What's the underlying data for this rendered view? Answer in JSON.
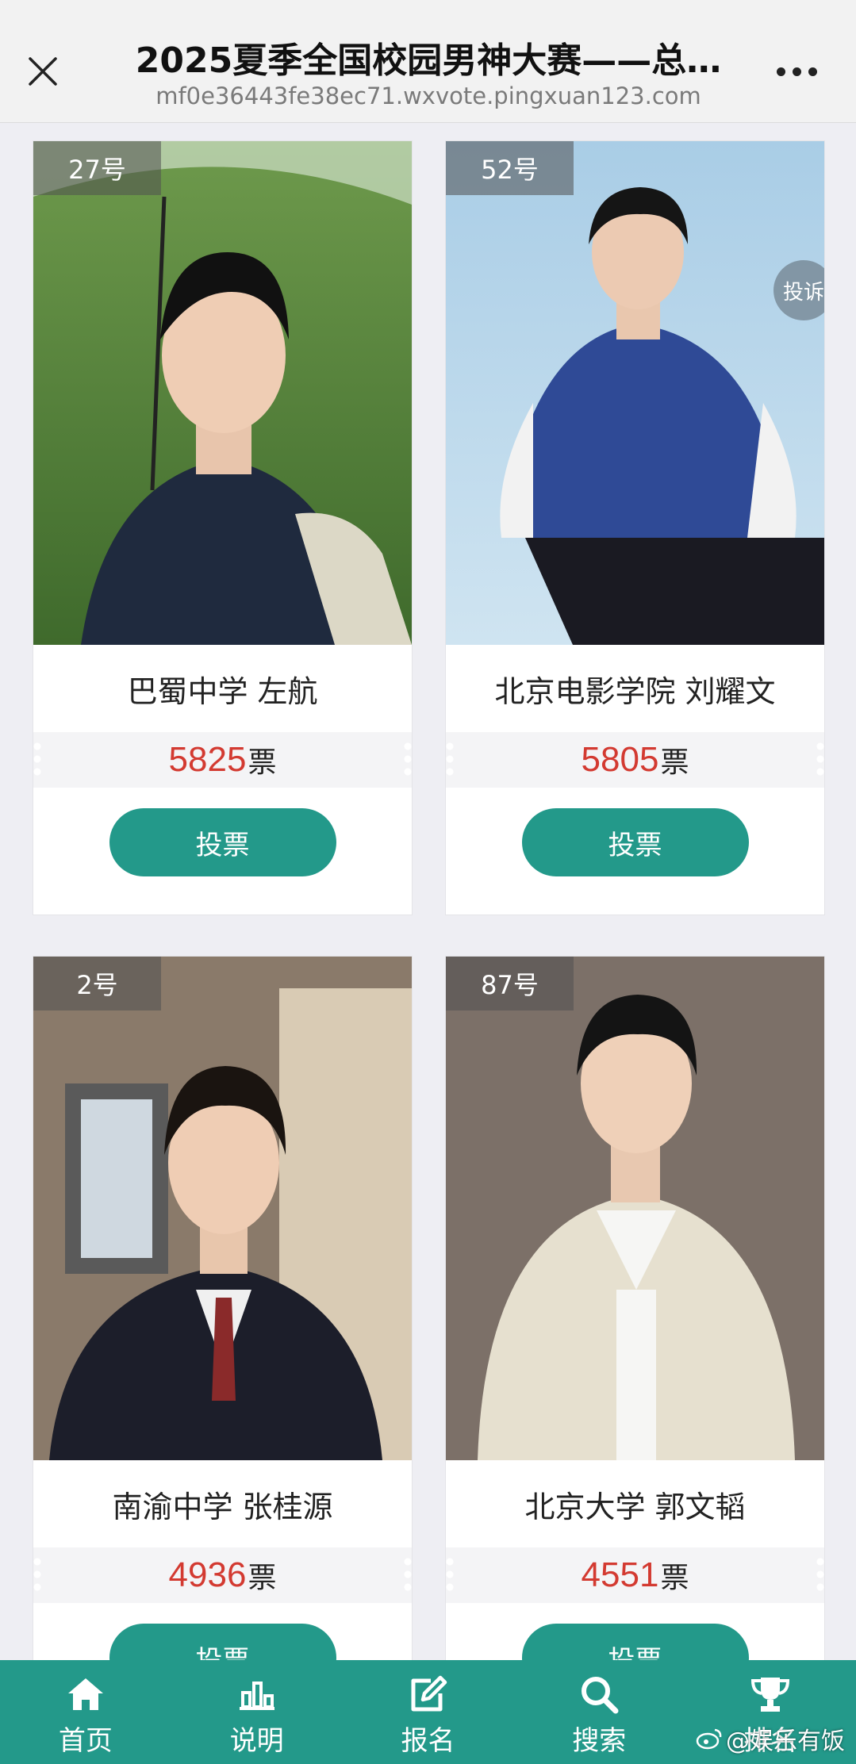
{
  "header": {
    "title": "2025夏季全国校园男神大赛——总…",
    "url": "mf0e36443fe38ec71.wxvote.pingxuan123.com"
  },
  "cards": [
    {
      "badge": "27号",
      "name": "巴蜀中学 左航",
      "votes": "5825",
      "unit": "票",
      "vote_label": "投票"
    },
    {
      "badge": "52号",
      "name": "北京电影学院 刘耀文",
      "votes": "5805",
      "unit": "票",
      "vote_label": "投票",
      "complain": "投诉"
    },
    {
      "badge": "2号",
      "name": "南渝中学 张桂源",
      "votes": "4936",
      "unit": "票",
      "vote_label": "投票"
    },
    {
      "badge": "87号",
      "name": "北京大学 郭文韬",
      "votes": "4551",
      "unit": "票",
      "vote_label": "投票"
    }
  ],
  "nav": {
    "items": [
      {
        "label": "首页",
        "icon": "home-icon"
      },
      {
        "label": "说明",
        "icon": "chart-icon"
      },
      {
        "label": "报名",
        "icon": "edit-icon"
      },
      {
        "label": "搜索",
        "icon": "search-icon"
      },
      {
        "label": "排名",
        "icon": "trophy-icon"
      }
    ]
  },
  "watermark": "@娱乐有饭",
  "colors": {
    "accent": "#23998a",
    "vote_count": "#d33a31",
    "header_bg": "#f2f2f2",
    "page_bg": "#eeeef3"
  }
}
